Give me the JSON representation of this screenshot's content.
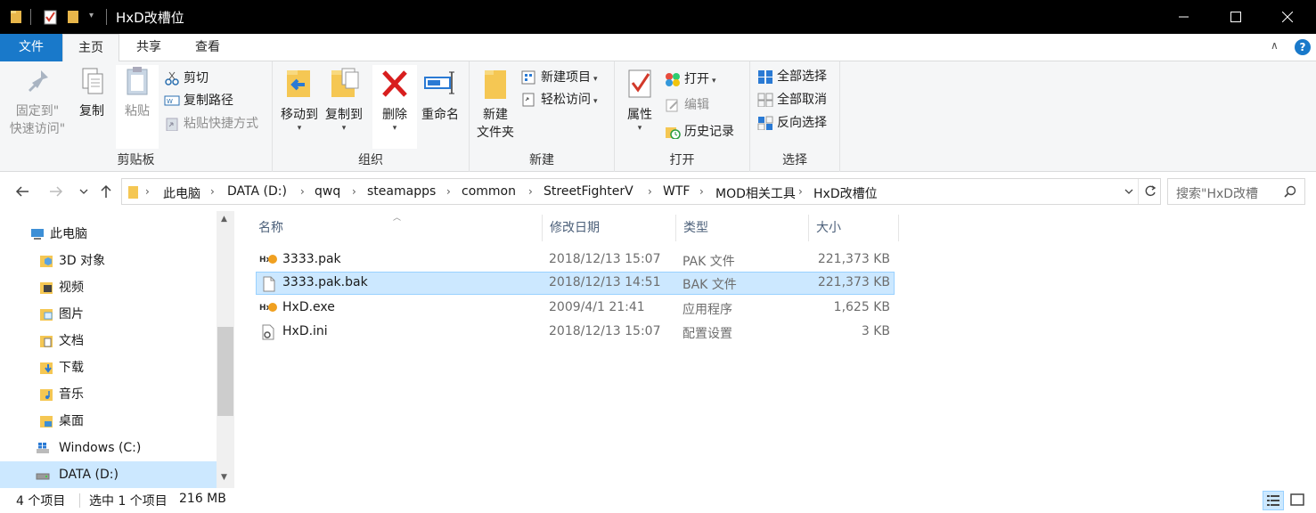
{
  "window": {
    "title": "HxD改槽位"
  },
  "tabs": {
    "file": "文件",
    "home": "主页",
    "share": "共享",
    "view": "查看"
  },
  "ribbon": {
    "clipboard": {
      "label": "剪贴板",
      "pin_line1": "固定到\"",
      "pin_line2": "快速访问\"",
      "copy": "复制",
      "paste": "粘贴",
      "cut": "剪切",
      "copy_path": "复制路径",
      "paste_shortcut": "粘贴快捷方式"
    },
    "organize": {
      "label": "组织",
      "move_to": "移动到",
      "copy_to": "复制到",
      "delete": "删除",
      "rename": "重命名"
    },
    "new": {
      "label": "新建",
      "new_folder_line1": "新建",
      "new_folder_line2": "文件夹",
      "new_item": "新建项目",
      "easy_access": "轻松访问"
    },
    "open": {
      "label": "打开",
      "properties": "属性",
      "open": "打开",
      "edit": "编辑",
      "history": "历史记录"
    },
    "select": {
      "label": "选择",
      "select_all": "全部选择",
      "select_none": "全部取消",
      "invert": "反向选择"
    }
  },
  "address": {
    "crumbs": [
      "此电脑",
      "DATA (D:)",
      "qwq",
      "steamapps",
      "common",
      "StreetFighterV",
      "WTF",
      "MOD相关工具",
      "HxD改槽位"
    ],
    "search_placeholder": "搜索\"HxD改槽"
  },
  "nav": {
    "items": [
      "此电脑",
      "3D 对象",
      "视频",
      "图片",
      "文档",
      "下载",
      "音乐",
      "桌面",
      "Windows (C:)",
      "DATA (D:)"
    ]
  },
  "columns": {
    "name": "名称",
    "modified": "修改日期",
    "type": "类型",
    "size": "大小"
  },
  "files": [
    {
      "name": "3333.pak",
      "modified": "2018/12/13 15:07",
      "type": "PAK 文件",
      "size": "221,373 KB"
    },
    {
      "name": "3333.pak.bak",
      "modified": "2018/12/13 14:51",
      "type": "BAK 文件",
      "size": "221,373 KB"
    },
    {
      "name": "HxD.exe",
      "modified": "2009/4/1 21:41",
      "type": "应用程序",
      "size": "1,625 KB"
    },
    {
      "name": "HxD.ini",
      "modified": "2018/12/13 15:07",
      "type": "配置设置",
      "size": "3 KB"
    }
  ],
  "status": {
    "count": "4 个项目",
    "selected": "选中 1 个项目",
    "size": "216 MB"
  },
  "colors": {
    "accent": "#1979ca",
    "selection": "#cce8ff"
  }
}
